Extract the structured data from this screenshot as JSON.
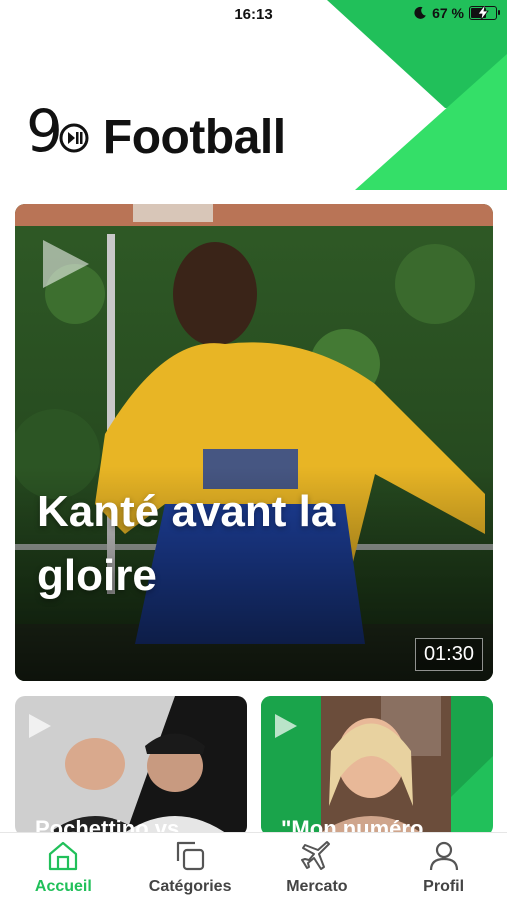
{
  "status_bar": {
    "time": "16:13",
    "battery": "67 %",
    "battery_level": 0.67
  },
  "header": {
    "logo_prefix": "9",
    "logo_text": "Football"
  },
  "hero": {
    "title": "Kanté avant la gloire",
    "duration": "01:30"
  },
  "cards": [
    {
      "title": "Pochettino vs"
    },
    {
      "title": "\"Mon numéro"
    }
  ],
  "tabbar": {
    "active": "Accueil",
    "items": [
      {
        "label": "Accueil",
        "icon": "home-icon"
      },
      {
        "label": "Catégories",
        "icon": "categories-icon"
      },
      {
        "label": "Mercato",
        "icon": "airplane-icon"
      },
      {
        "label": "Profil",
        "icon": "user-icon"
      }
    ]
  },
  "colors": {
    "accent": "#21c05a",
    "accent_light": "#34df68"
  }
}
